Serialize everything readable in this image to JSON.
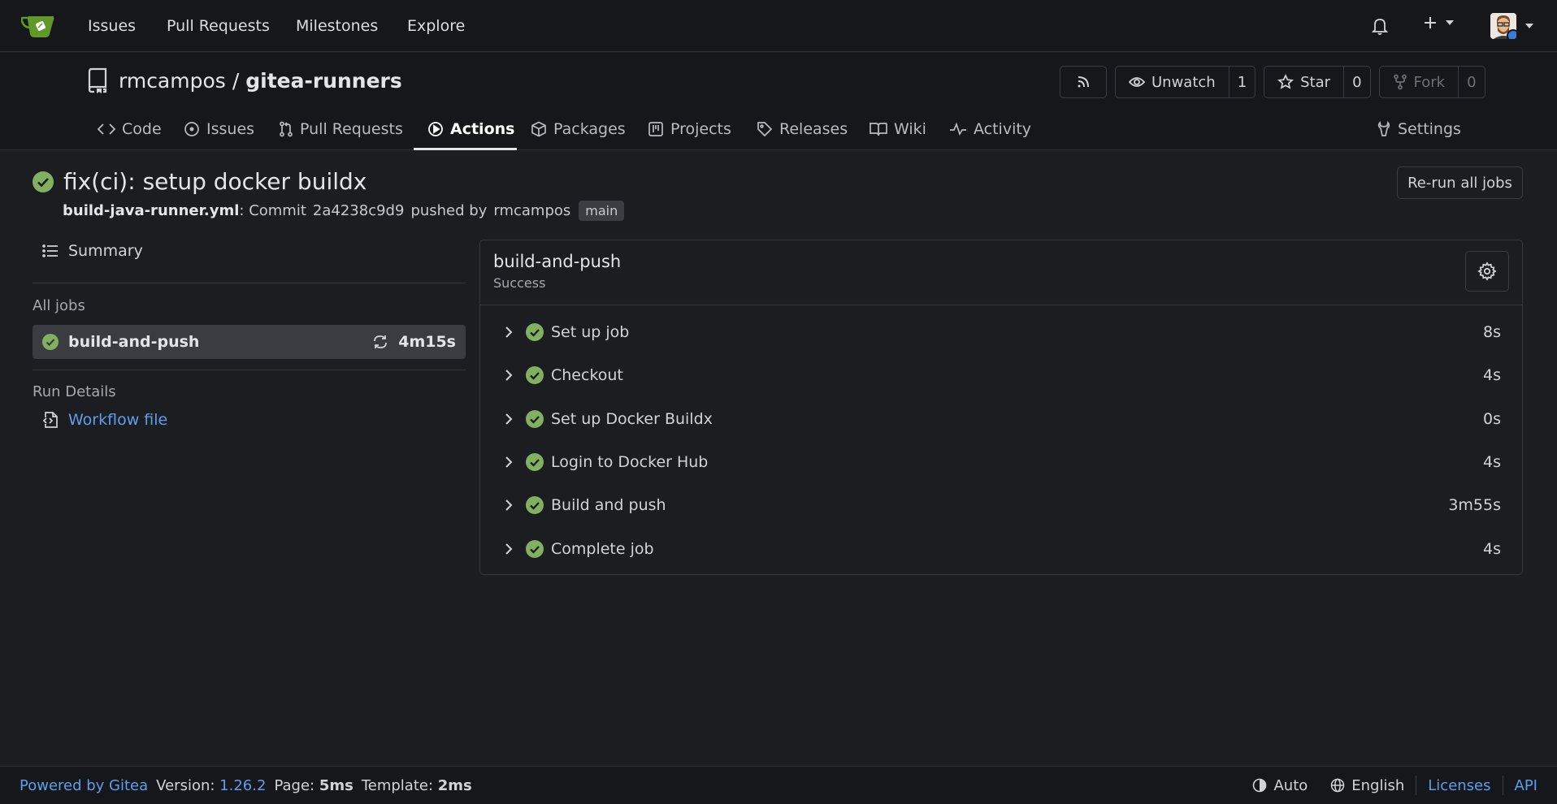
{
  "topnav": {
    "items": [
      "Issues",
      "Pull Requests",
      "Milestones",
      "Explore"
    ]
  },
  "repo": {
    "owner": "rmcampos",
    "separator": "/",
    "name": "gitea-runners",
    "unwatch_label": "Unwatch",
    "watch_count": "1",
    "star_label": "Star",
    "star_count": "0",
    "fork_label": "Fork",
    "fork_count": "0"
  },
  "tabs": [
    {
      "label": "Code"
    },
    {
      "label": "Issues"
    },
    {
      "label": "Pull Requests"
    },
    {
      "label": "Actions"
    },
    {
      "label": "Packages"
    },
    {
      "label": "Projects"
    },
    {
      "label": "Releases"
    },
    {
      "label": "Wiki"
    },
    {
      "label": "Activity"
    },
    {
      "label": "Settings"
    }
  ],
  "run": {
    "title": "fix(ci): setup docker buildx",
    "workflow_file": "build-java-runner.yml",
    "commit_prefix": ": Commit",
    "commit_sha": "2a4238c9d9",
    "pushed_by": "pushed by",
    "author": "rmcampos",
    "branch": "main",
    "rerun_label": "Re-run all jobs"
  },
  "sidebar": {
    "summary_label": "Summary",
    "all_jobs_label": "All jobs",
    "job": {
      "name": "build-and-push",
      "duration": "4m15s"
    },
    "run_details_label": "Run Details",
    "workflow_link": "Workflow file"
  },
  "job_panel": {
    "title": "build-and-push",
    "status": "Success",
    "steps": [
      {
        "name": "Set up job",
        "duration": "8s"
      },
      {
        "name": "Checkout",
        "duration": "4s"
      },
      {
        "name": "Set up Docker Buildx",
        "duration": "0s"
      },
      {
        "name": "Login to Docker Hub",
        "duration": "4s"
      },
      {
        "name": "Build and push",
        "duration": "3m55s"
      },
      {
        "name": "Complete job",
        "duration": "4s"
      }
    ]
  },
  "footer": {
    "powered_by": "Powered by Gitea",
    "version_label": "Version:",
    "version": "1.26.2",
    "page_label": "Page:",
    "page_time": "5ms",
    "template_label": "Template:",
    "template_time": "2ms",
    "theme": "Auto",
    "language": "English",
    "licenses": "Licenses",
    "api": "API"
  },
  "colors": {
    "success": "#81b060",
    "link": "#5e9dec",
    "logo": "#609926"
  }
}
